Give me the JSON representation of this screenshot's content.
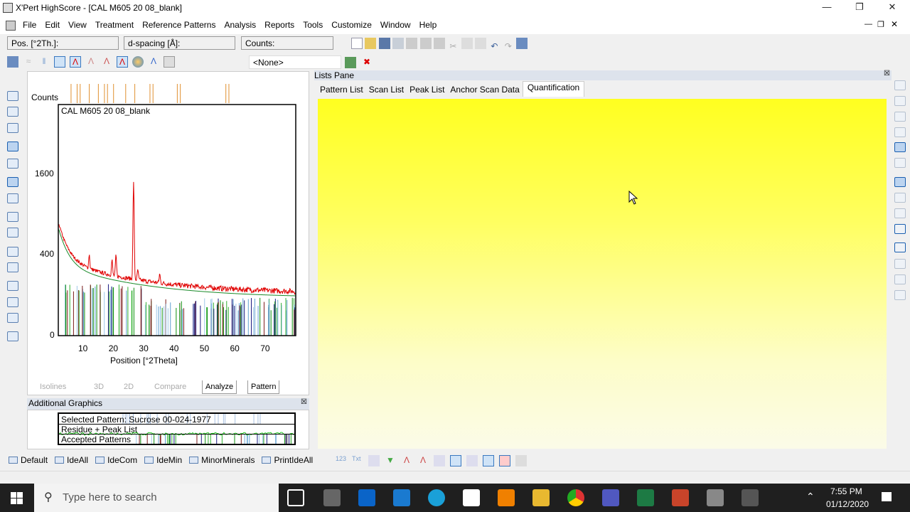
{
  "window": {
    "title": "X'Pert HighScore - [CAL M605 20 08_blank]"
  },
  "menu": [
    "File",
    "Edit",
    "View",
    "Treatment",
    "Reference Patterns",
    "Analysis",
    "Reports",
    "Tools",
    "Customize",
    "Window",
    "Help"
  ],
  "statusfields": {
    "pos": "Pos. [°2Th.]:",
    "dspacing": "d-spacing [Å]:",
    "counts": "Counts:"
  },
  "selector": {
    "value": "<None>"
  },
  "plot": {
    "title": "CAL M605 20 08_blank",
    "ylabel": "Counts",
    "xlabel": "Position [°2Theta]",
    "yticks": [
      "1600",
      "400",
      "0"
    ],
    "xticks": [
      "10",
      "20",
      "30",
      "40",
      "50",
      "60",
      "70"
    ],
    "colors": {
      "scan": "#e00000",
      "background": "#1a8a2a"
    }
  },
  "viewtabs": [
    "Isolines",
    "3D",
    "2D",
    "Compare",
    "Analyze",
    "Pattern"
  ],
  "additional": {
    "title": "Additional Graphics",
    "rows": [
      "Selected Pattern: Sucrose  00-024-1977",
      "Residue + Peak List",
      "Accepted Patterns"
    ]
  },
  "lists": {
    "title": "Lists Pane",
    "tabs": [
      "Pattern List",
      "Scan List",
      "Peak List",
      "Anchor Scan Data",
      "Quantification"
    ],
    "active": "Quantification"
  },
  "bottombar": [
    "Default",
    "IdeAll",
    "IdeCom",
    "IdeMin",
    "MinorMinerals",
    "PrintIdeAll"
  ],
  "taskbar": {
    "search_placeholder": "Type here to search",
    "time": "7:55 PM",
    "date": "01/12/2020"
  }
}
